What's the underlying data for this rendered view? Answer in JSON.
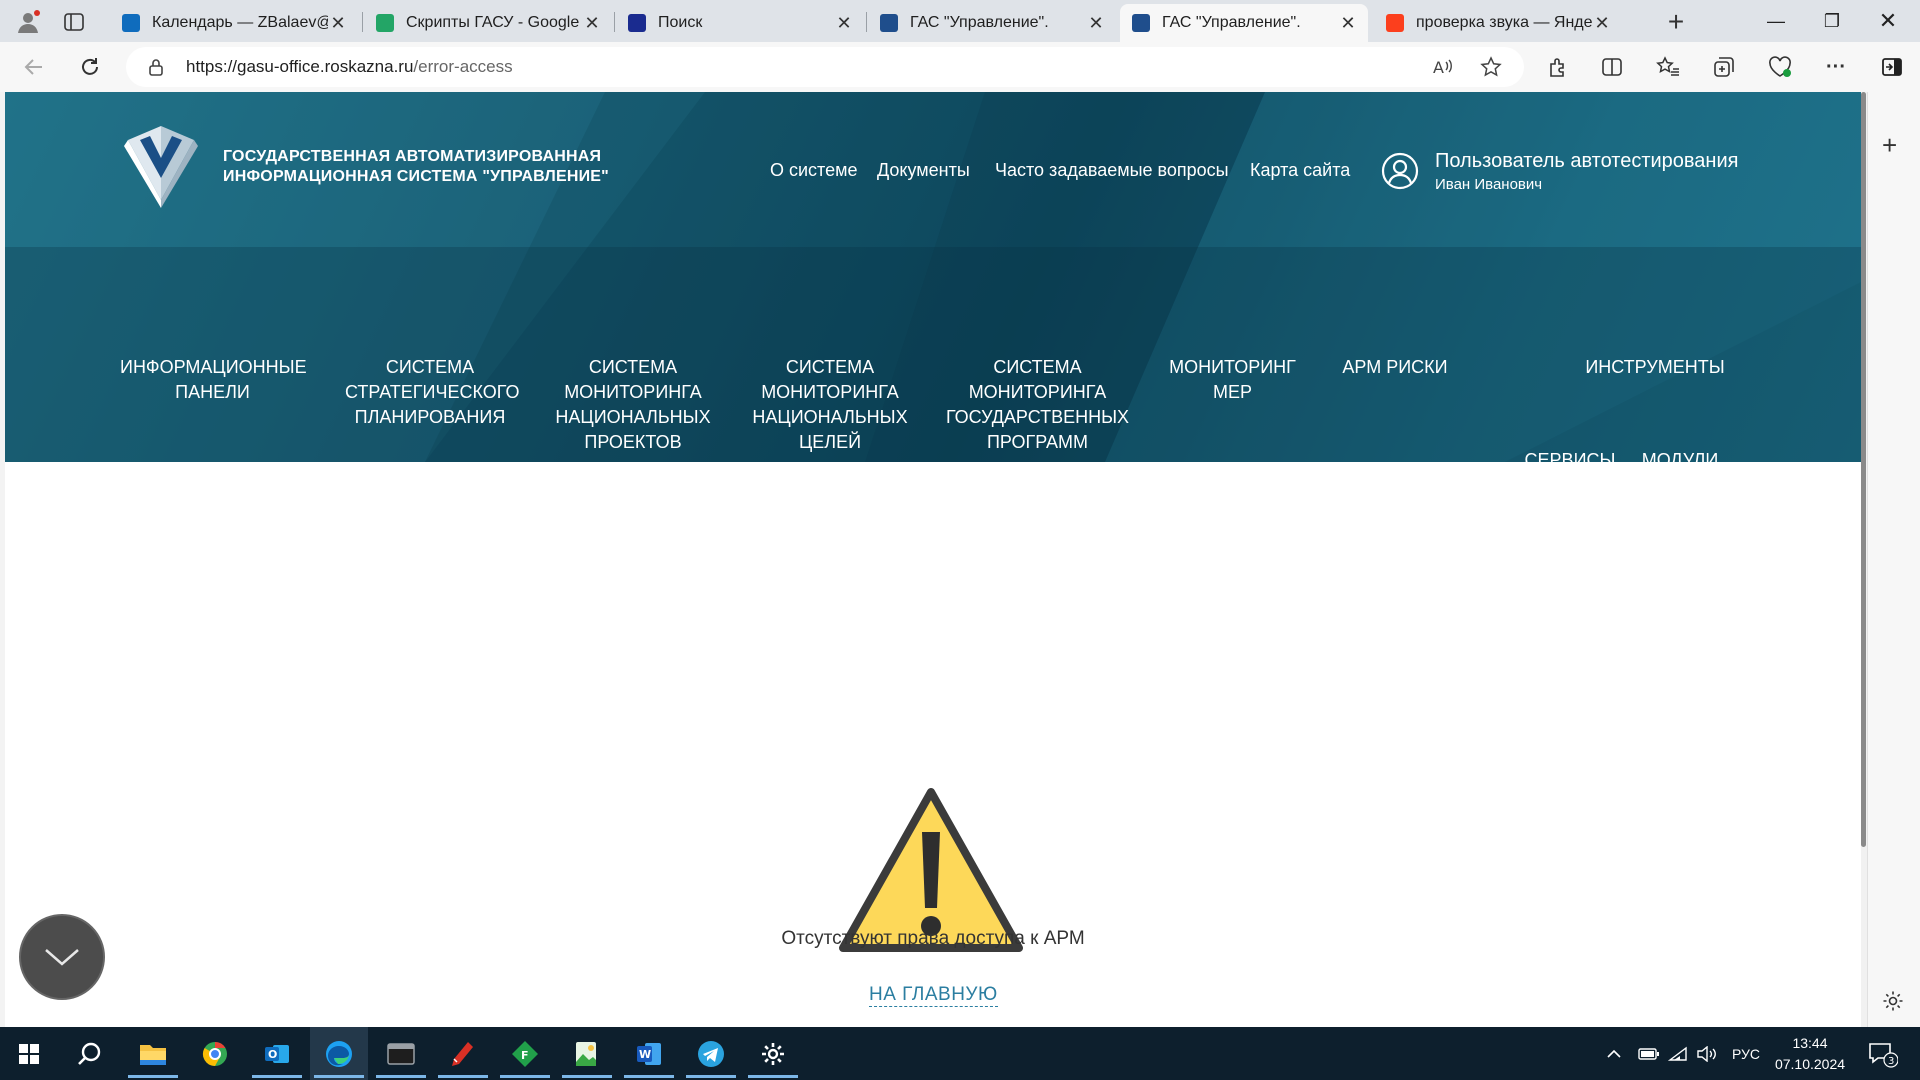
{
  "browser": {
    "tabs": [
      {
        "title": "Календарь — ZBalaev@IBS",
        "favicon": "outlook-icon",
        "color": "#0f6cbd"
      },
      {
        "title": "Скрипты ГАСУ - Google Та",
        "favicon": "sheets-icon",
        "color": "#23a566"
      },
      {
        "title": "Поиск",
        "favicon": "ibs-icon",
        "color": "#1a2b8f"
      },
      {
        "title": "ГАС \"Управление\".",
        "favicon": "gasu-icon",
        "color": "#1f4e8c"
      },
      {
        "title": "ГАС \"Управление\".",
        "favicon": "gasu-icon",
        "color": "#1f4e8c",
        "active": true
      },
      {
        "title": "проверка звука — Яндекс",
        "favicon": "yandex-icon",
        "color": "#fc3f1d"
      }
    ],
    "url_host": "https://gasu-office.roskazna.ru",
    "url_path": "/error-access"
  },
  "site": {
    "logo_line1": "ГОСУДАРСТВЕННАЯ АВТОМАТИЗИРОВАННАЯ",
    "logo_line2": "ИНФОРМАЦИОННАЯ СИСТЕМА \"УПРАВЛЕНИЕ\"",
    "top_links": [
      "О системе",
      "Документы",
      "Часто задаваемые вопросы",
      "Карта сайта"
    ],
    "user_name": "Пользователь автотестирования",
    "user_sub": "Иван Иванович",
    "menu": [
      "Информационные панели",
      "Система стратегического планирования",
      "Система мониторинга национальных проектов",
      "Система мониторинга национальных целей",
      "Система мониторинга государственных программ",
      "Мониторинг мер",
      "АРМ Риски",
      "Инструменты",
      "Сервисы",
      "Модули"
    ]
  },
  "error": {
    "message": "Отсутствуют права доступа к АРМ",
    "home_link": "НА ГЛАВНУЮ"
  },
  "taskbar": {
    "apps": [
      "start-icon",
      "search-icon",
      "file-explorer-icon",
      "chrome-icon",
      "outlook-icon",
      "edge-icon",
      "terminal-icon",
      "pen-icon",
      "fin-app-icon",
      "image-app-icon",
      "word-icon",
      "telegram-icon",
      "settings-icon"
    ],
    "language": "РУС",
    "time": "13:44",
    "date": "07.10.2024",
    "notifications": "3"
  }
}
